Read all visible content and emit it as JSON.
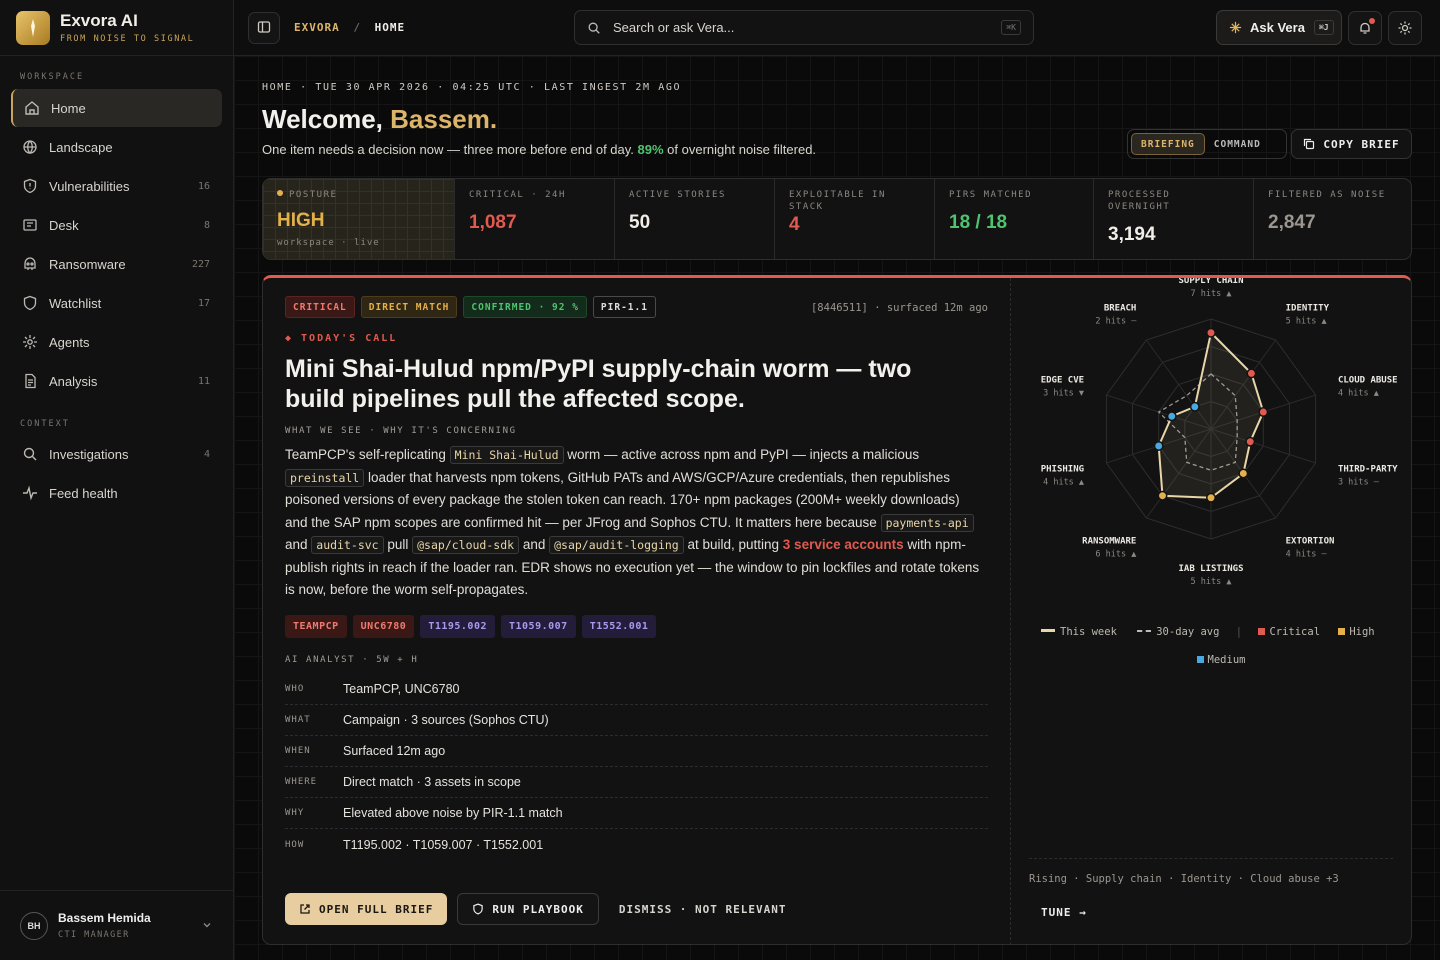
{
  "brand": {
    "name": "Exvora AI",
    "tagline": "FROM NOISE TO SIGNAL"
  },
  "sidebar": {
    "workspace_label": "WORKSPACE",
    "context_label": "CONTEXT",
    "items": [
      {
        "label": "Home",
        "count": "",
        "icon": "home-icon"
      },
      {
        "label": "Landscape",
        "count": "",
        "icon": "globe-icon"
      },
      {
        "label": "Vulnerabilities",
        "count": "16",
        "icon": "shield-icon"
      },
      {
        "label": "Desk",
        "count": "8",
        "icon": "desk-icon"
      },
      {
        "label": "Ransomware",
        "count": "227",
        "icon": "ransomware-icon"
      },
      {
        "label": "Watchlist",
        "count": "17",
        "icon": "shield-outline-icon"
      },
      {
        "label": "Agents",
        "count": "",
        "icon": "agents-icon"
      },
      {
        "label": "Analysis",
        "count": "11",
        "icon": "document-icon"
      }
    ],
    "context_items": [
      {
        "label": "Investigations",
        "count": "4",
        "icon": "search-icon"
      },
      {
        "label": "Feed health",
        "count": "",
        "icon": "pulse-icon"
      }
    ],
    "user": {
      "initials": "BH",
      "name": "Bassem Hemida",
      "role": "CTI MANAGER"
    }
  },
  "topbar": {
    "breadcrumb_root": "EXVORA",
    "breadcrumb_sep": "/",
    "breadcrumb_current": "HOME",
    "search_placeholder": "Search or ask Vera...",
    "search_kbd": "⌘K",
    "ask_label": "Ask Vera",
    "ask_kbd": "⌘J"
  },
  "header": {
    "meta": "HOME · TUE 30 APR 2026 · 04:25 UTC · LAST INGEST 2M AGO",
    "welcome_prefix": "Welcome, ",
    "welcome_name": "Bassem.",
    "sub_prefix": "One item needs a decision now — three more before end of day. ",
    "sub_pct": "89%",
    "sub_suffix": " of overnight noise filtered.",
    "toggle": [
      "BRIEFING",
      "COMMAND"
    ],
    "copy_label": "COPY BRIEF"
  },
  "stats": [
    {
      "label": "POSTURE",
      "value": "HIGH",
      "foot": "workspace · live",
      "color": "#e3b04b"
    },
    {
      "label": "CRITICAL · 24H",
      "value": "1,087",
      "color": "#e05a4f"
    },
    {
      "label": "ACTIVE STORIES",
      "value": "50",
      "color": "#f1eee8"
    },
    {
      "label": "EXPLOITABLE IN STACK",
      "value": "4",
      "color": "#e05a4f"
    },
    {
      "label": "PIRS MATCHED",
      "value": "18 / 18",
      "color": "#4fc36f"
    },
    {
      "label": "PROCESSED OVERNIGHT",
      "value": "3,194",
      "color": "#f1eee8"
    },
    {
      "label": "FILTERED AS NOISE",
      "value": "2,847",
      "color": "#9b978f"
    }
  ],
  "card": {
    "badges": [
      "CRITICAL",
      "DIRECT MATCH",
      "CONFIRMED · 92 %",
      "PIR-1.1"
    ],
    "surfaced": "[8446511] · surfaced 12m ago",
    "today": "◆ TODAY'S CALL",
    "headline": "Mini Shai-Hulud npm/PyPI supply-chain worm — two build pipelines pull the affected scope.",
    "what_we_see": "WHAT WE SEE · WHY IT'S CONCERNING",
    "body": {
      "t1": "TeamPCP's self-replicating ",
      "c1": "Mini Shai-Hulud",
      "t2": " worm — active across npm and PyPI — injects a malicious ",
      "c2": "preinstall",
      "t3": " loader that harvests npm tokens, GitHub PATs and AWS/GCP/Azure credentials, then republishes poisoned versions of every package the stolen token can reach. 170+ npm packages (200M+ weekly downloads) and the SAP npm scopes are confirmed hit — per JFrog and Sophos CTU. It matters here because ",
      "c3": "payments-api",
      "t4": " and ",
      "c4": "audit-svc",
      "t5": " pull ",
      "c5": "@sap/cloud-sdk",
      "t6": " and ",
      "c6": "@sap/audit-logging",
      "t7": " at build, putting ",
      "red": "3 service accounts",
      "t8": " with npm-publish rights in reach if the loader ran. EDR shows no execution yet — the window to pin lockfiles and rotate tokens is now, before the worm self-propagates."
    },
    "tags": [
      "TEAMPCP",
      "UNC6780",
      "T1195.002",
      "T1059.007",
      "T1552.001"
    ],
    "ai_header": "AI ANALYST · 5W + H",
    "rows": [
      {
        "k": "WHO",
        "v": "TeamPCP, UNC6780"
      },
      {
        "k": "WHAT",
        "v": "Campaign · 3 sources (Sophos CTU)"
      },
      {
        "k": "WHEN",
        "v": "Surfaced 12m ago"
      },
      {
        "k": "WHERE",
        "v": "Direct match · 3 assets in scope"
      },
      {
        "k": "WHY",
        "v": "Elevated above noise by PIR-1.1 match"
      },
      {
        "k": "HOW",
        "v": "T1195.002 · T1059.007 · T1552.001"
      }
    ],
    "actions": {
      "open": "OPEN FULL BRIEF",
      "run": "RUN PLAYBOOK",
      "dismiss": "DISMISS · NOT RELEVANT"
    }
  },
  "radar": {
    "axes": [
      {
        "name": "SUPPLY CHAIN",
        "hits": "7 hits ▲"
      },
      {
        "name": "IDENTITY",
        "hits": "5 hits ▲"
      },
      {
        "name": "CLOUD ABUSE",
        "hits": "4 hits ▲"
      },
      {
        "name": "THIRD-PARTY",
        "hits": "3 hits –"
      },
      {
        "name": "EXTORTION",
        "hits": "4 hits –"
      },
      {
        "name": "IAB LISTINGS",
        "hits": "5 hits ▲"
      },
      {
        "name": "RANSOMWARE",
        "hits": "6 hits ▲"
      },
      {
        "name": "PHISHING",
        "hits": "4 hits ▲"
      },
      {
        "name": "EDGE CVE",
        "hits": "3 hits ▼"
      },
      {
        "name": "BREACH",
        "hits": "2 hits –"
      }
    ],
    "this_week": [
      7,
      5,
      4,
      3,
      4,
      5,
      6,
      4,
      3,
      2
    ],
    "avg_30d": [
      4,
      3,
      2,
      2,
      3,
      3,
      3,
      2,
      4,
      3
    ],
    "severity": [
      "critical",
      "critical",
      "critical",
      "critical",
      "high",
      "high",
      "high",
      "medium",
      "medium",
      "medium"
    ],
    "max": 8,
    "legend": {
      "this_week": "This week",
      "avg": "30-day avg",
      "critical": "Critical",
      "high": "High",
      "medium": "Medium"
    },
    "colors": {
      "critical": "#e05a4f",
      "high": "#e3b04b",
      "medium": "#4aa8e0",
      "line": "#e8d6a8"
    },
    "rising": "Rising · Supply chain · Identity · Cloud abuse +3",
    "tune": "TUNE →"
  }
}
